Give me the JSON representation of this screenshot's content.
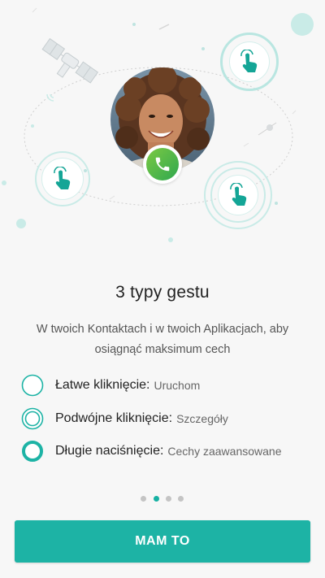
{
  "onboarding": {
    "title": "3 typy gestu",
    "subtitle": "W twoich Kontaktach i w twoich Aplikacjach, aby osiągnąć maksimum cech",
    "gestures": [
      {
        "name": "Łatwe kliknięcie:",
        "description": "Uruchom",
        "icon": "single-ring-icon"
      },
      {
        "name": "Podwójne kliknięcie:",
        "description": "Szczegóły",
        "icon": "double-ring-icon"
      },
      {
        "name": "Długie naciśnięcie:",
        "description": "Cechy zaawansowane",
        "icon": "thick-ring-icon"
      }
    ],
    "page_indicator": {
      "total": 4,
      "current": 2
    },
    "cta_label": "MAM TO"
  },
  "colors": {
    "accent": "#1db3a5",
    "teal_light": "#b9e6e1",
    "call_green": "#3daf4f",
    "background": "#f7f7f7"
  }
}
